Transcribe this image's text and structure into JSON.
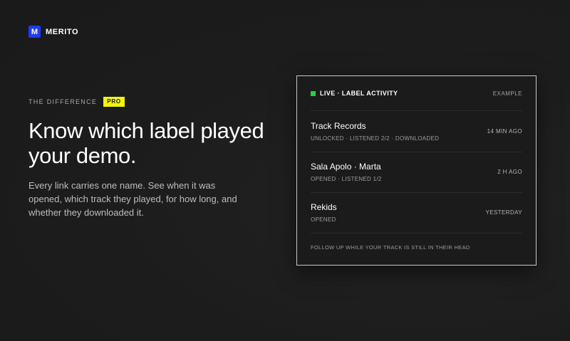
{
  "brand": {
    "logo_letter": "M",
    "name": "MERITO",
    "accent_color": "#1f3cf0"
  },
  "hero": {
    "eyebrow": "THE DIFFERENCE",
    "badge": "PRO",
    "headline": "Know which label played your demo.",
    "body": "Every link carries one name. See when it was opened, which track they played, for how long, and whether they downloaded it."
  },
  "activity_card": {
    "live_label": "LIVE · LABEL ACTIVITY",
    "tag": "EXAMPLE",
    "live_color": "#22d13d",
    "rows": [
      {
        "title": "Track Records",
        "status": "UNLOCKED · LISTENED 2/2 · DOWNLOADED",
        "time": "14 MIN AGO"
      },
      {
        "title": "Sala Apolo · Marta",
        "status": "OPENED · LISTENED 1/2",
        "time": "2 H AGO"
      },
      {
        "title": "Rekids",
        "status": "OPENED",
        "time": "YESTERDAY"
      }
    ],
    "footer": "FOLLOW UP WHILE YOUR TRACK IS STILL IN THEIR HEAD"
  }
}
